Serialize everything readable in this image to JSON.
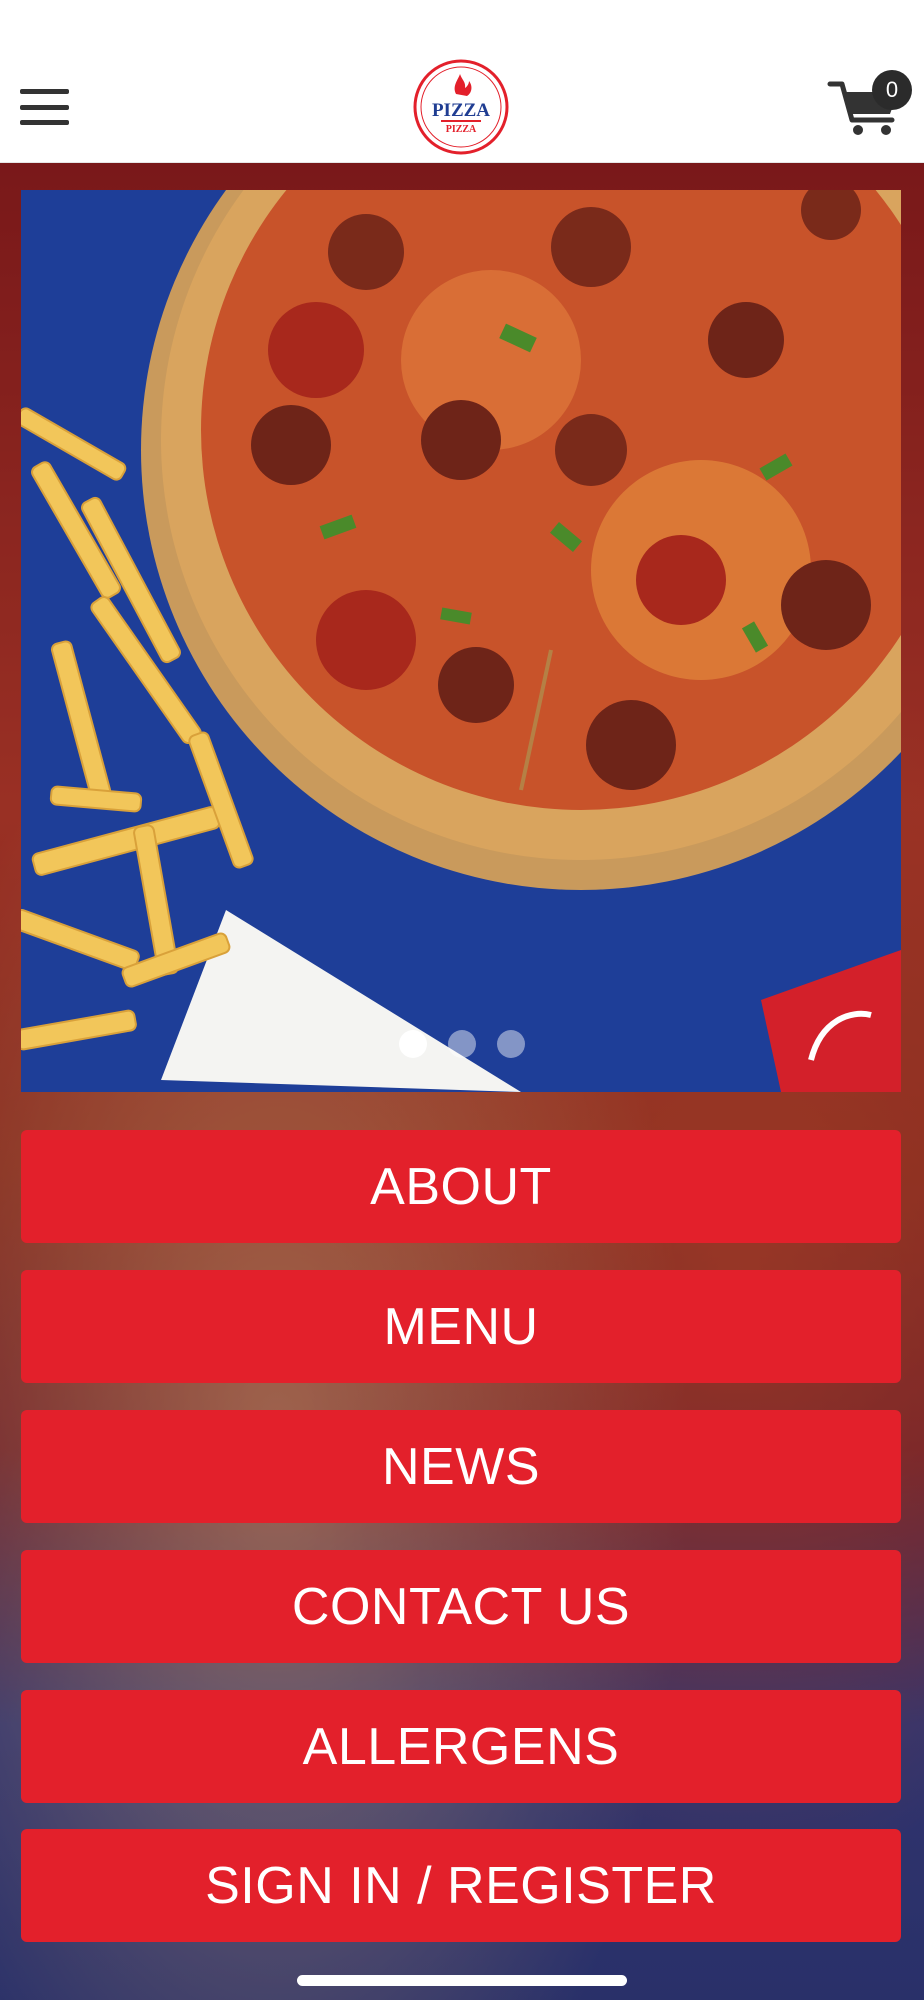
{
  "header": {
    "menu_icon": "hamburger-menu-icon",
    "logo_text_top": "PIZZA",
    "logo_text_bottom": "PIZZA",
    "cart_icon": "shopping-cart-icon",
    "cart_count": "0"
  },
  "carousel": {
    "slide_count": 3,
    "active_index": 0
  },
  "buttons": {
    "about": "ABOUT",
    "menu": "MENU",
    "news": "NEWS",
    "contact": "CONTACT US",
    "allergens": "ALLERGENS",
    "signin": "SIGN IN / REGISTER"
  },
  "colors": {
    "button_red": "#e3202b",
    "logo_blue": "#1f3d92",
    "logo_red": "#e3202b"
  }
}
